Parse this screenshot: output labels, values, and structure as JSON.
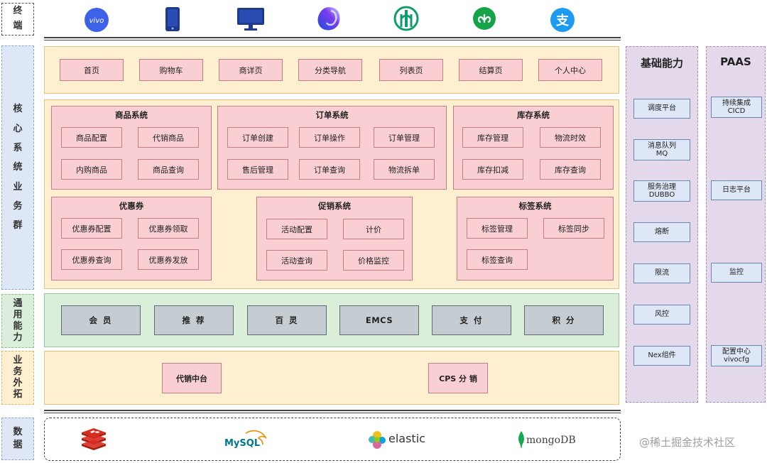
{
  "layers": {
    "terminal": "终端",
    "core": "核心系统业务群",
    "general": "通用能力",
    "business_ext": "业务外拓",
    "data": "数据"
  },
  "terminals": [
    {
      "name": "vivo",
      "icon": "vivo-logo-icon"
    },
    {
      "name": "phone",
      "icon": "phone-icon"
    },
    {
      "name": "pc",
      "icon": "monitor-icon"
    },
    {
      "name": "quickapp",
      "icon": "quickapp-icon"
    },
    {
      "name": "bank",
      "icon": "bank-icon"
    },
    {
      "name": "mini-program",
      "icon": "mini-program-icon"
    },
    {
      "name": "alipay",
      "icon": "alipay-icon"
    }
  ],
  "pages": [
    "首页",
    "购物车",
    "商详页",
    "分类导航",
    "列表页",
    "结算页",
    "个人中心"
  ],
  "systems": {
    "goods": {
      "title": "商品系统",
      "items": [
        "商品配置",
        "代销商品",
        "内购商品",
        "商品查询"
      ]
    },
    "order": {
      "title": "订单系统",
      "items": [
        "订单创建",
        "订单操作",
        "订单管理",
        "售后管理",
        "订单查询",
        "物流拆单"
      ]
    },
    "stock": {
      "title": "库存系统",
      "items": [
        "库存管理",
        "物流时效",
        "库存扣减",
        "库存查询"
      ]
    },
    "coupon": {
      "title": "优惠券",
      "items": [
        "优惠券配置",
        "优惠券领取",
        "优惠券查询",
        "优惠券发放"
      ]
    },
    "promo": {
      "title": "促销系统",
      "items": [
        "活动配置",
        "计价",
        "活动查询",
        "价格监控"
      ]
    },
    "tag": {
      "title": "标签系统",
      "items": [
        "标签管理",
        "标签同步",
        "标签查询"
      ]
    }
  },
  "general": [
    "会 员",
    "推 荐",
    "百 灵",
    "EMCS",
    "支 付",
    "积 分"
  ],
  "business": [
    "代销中台",
    "CPS 分 销"
  ],
  "data_stores": [
    {
      "name": "redis",
      "icon": "redis-icon",
      "label": ""
    },
    {
      "name": "MySQL",
      "icon": "mysql-icon",
      "label": "MySQL"
    },
    {
      "name": "elastic",
      "icon": "elastic-icon",
      "label": "elastic"
    },
    {
      "name": "mongoDB",
      "icon": "mongodb-icon",
      "label": "mongoDB"
    }
  ],
  "foundation": {
    "title": "基础能力",
    "items": [
      "调度平台",
      "消息队列\nMQ",
      "服务治理\nDUBBO",
      "熔断",
      "限流",
      "风控",
      "Nex组件"
    ]
  },
  "paas": {
    "title": "PAAS",
    "items": [
      "持续集成\nCICD",
      "日志平台",
      "监控",
      "配置中心\nvivocfg"
    ]
  },
  "watermark": "@稀土掘金技术社区",
  "colors": {
    "layer_label_bg": "#dde7f6",
    "yellow_bg": "#fdefcf",
    "pink_cell": "#f9cfd3",
    "green_bg": "#daeed9",
    "grey_cell": "#c5cdd3",
    "purple_bg": "#e4d9ea"
  }
}
